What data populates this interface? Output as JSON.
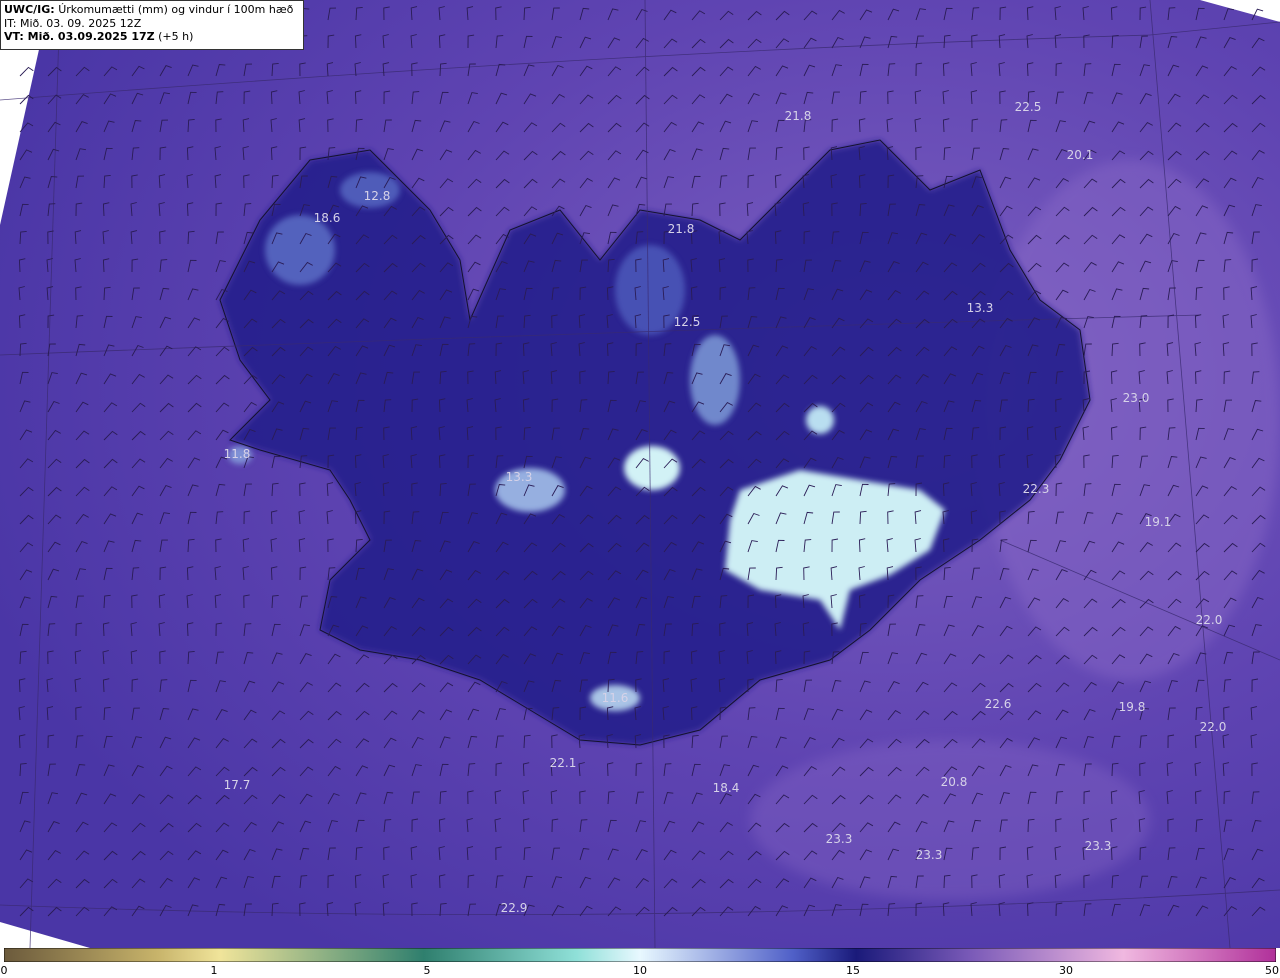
{
  "header": {
    "model": "UWC/IG:",
    "title": "Úrkomumætti (mm) og vindur í 100m hæð",
    "it_line": "IT: Mið. 03. 09. 2025 12Z",
    "vt_label": "VT: Mið. 03.09.2025 17Z",
    "vt_offset": "(+5 h)"
  },
  "map_labels": [
    {
      "text": "21.8"
    },
    {
      "text": "22.5"
    },
    {
      "text": "20.1"
    },
    {
      "text": "12.8"
    },
    {
      "text": "18.6"
    },
    {
      "text": "21.8"
    },
    {
      "text": "12.5"
    },
    {
      "text": "13.3"
    },
    {
      "text": "23.0"
    },
    {
      "text": "11.8"
    },
    {
      "text": "13.3"
    },
    {
      "text": "22.3"
    },
    {
      "text": "19.1"
    },
    {
      "text": "22.0"
    },
    {
      "text": "11.6"
    },
    {
      "text": "22.6"
    },
    {
      "text": "19.8"
    },
    {
      "text": "22.0"
    },
    {
      "text": "22.1"
    },
    {
      "text": "17.7"
    },
    {
      "text": "18.4"
    },
    {
      "text": "20.8"
    },
    {
      "text": "23.3"
    },
    {
      "text": "23.3"
    },
    {
      "text": "23.3"
    },
    {
      "text": "22.9"
    }
  ],
  "colorbar": {
    "ticks": [
      "0",
      "1",
      "5",
      "10",
      "15",
      "30",
      "50"
    ],
    "colors": [
      "#6b5a3c",
      "#c7b36a",
      "#f0e49a",
      "#2f7f6e",
      "#8fe0d8",
      "#e8f8ff",
      "#1a1a7a",
      "#3b2a9e",
      "#7a5ab8",
      "#f0b8e0",
      "#b0309a"
    ]
  },
  "colors": {
    "ocean": "#5a3fae",
    "land_dark": "#22208a",
    "precip_high": "#d8f4f6",
    "barb": "#2a1c55"
  }
}
